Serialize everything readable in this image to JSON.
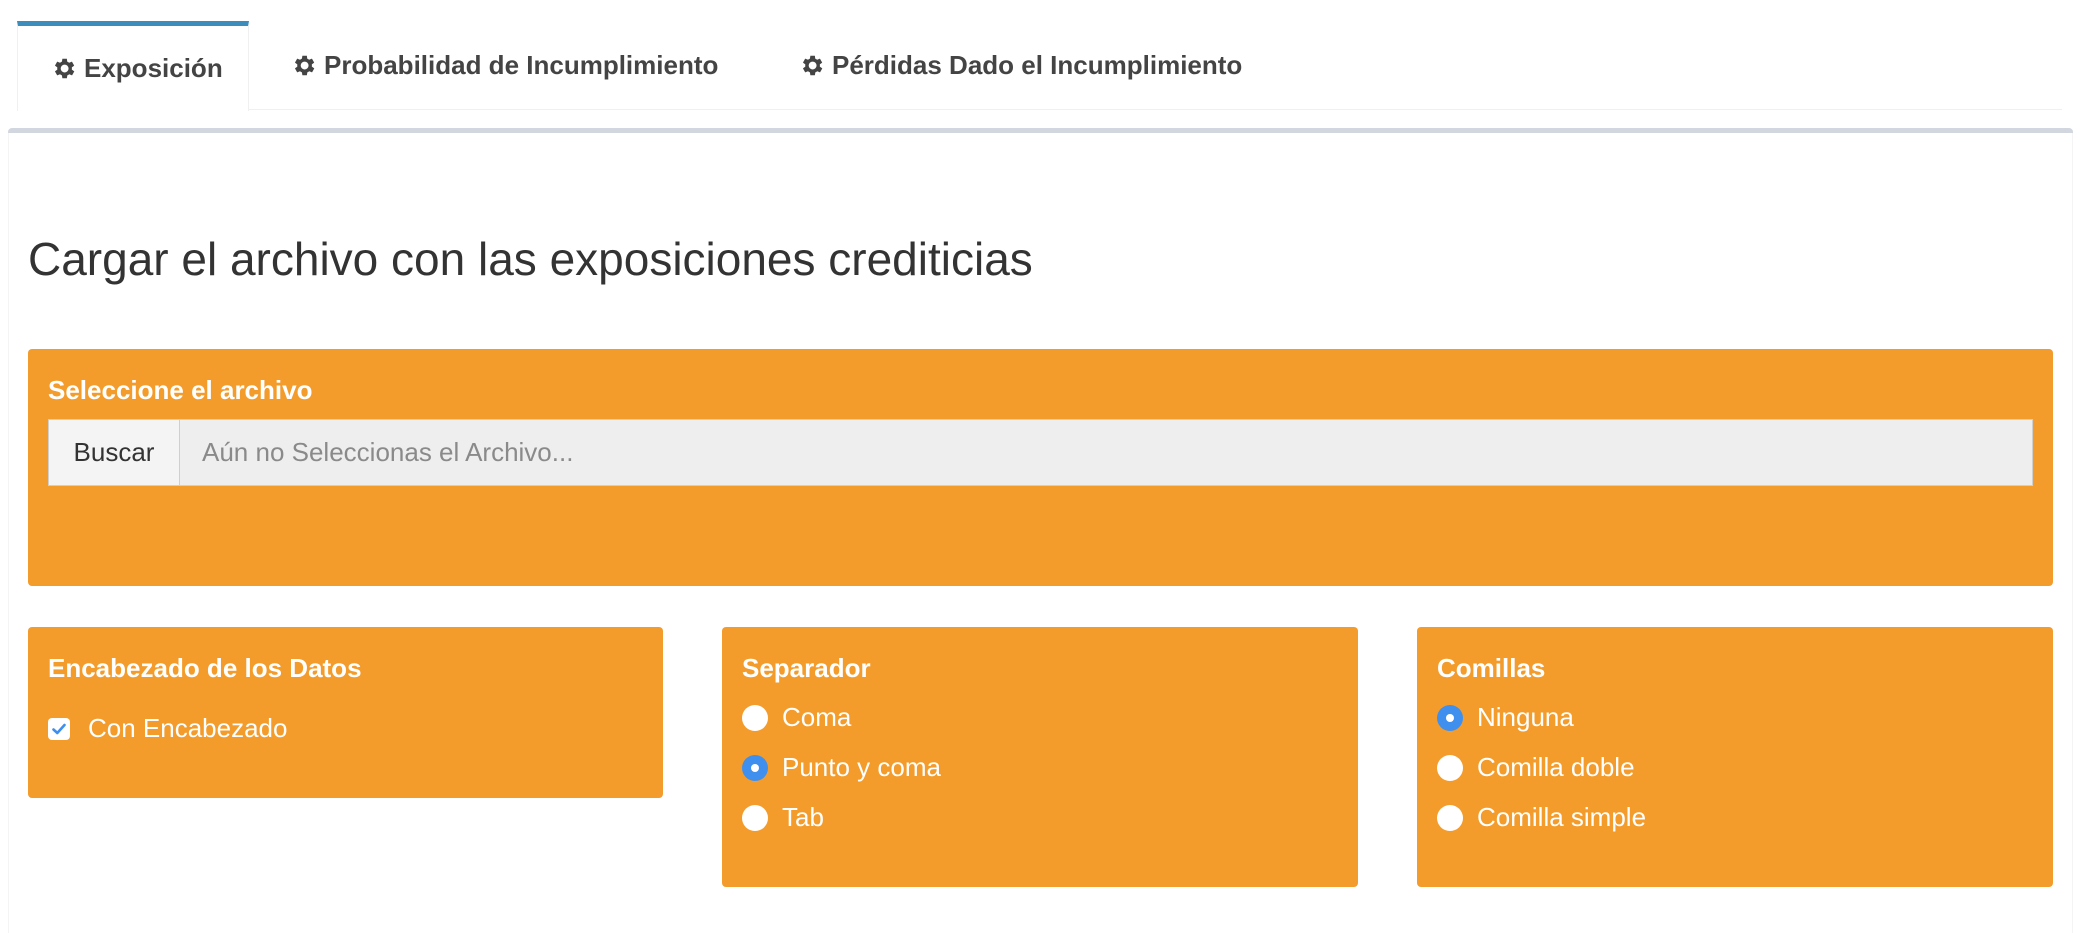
{
  "tabs": [
    {
      "label": "Exposición",
      "icon": "gear-icon",
      "active": true
    },
    {
      "label": "Probabilidad de Incumplimiento",
      "icon": "gear-icon",
      "active": false
    },
    {
      "label": "Pérdidas Dado el Incumplimiento",
      "icon": "gear-icon",
      "active": false
    }
  ],
  "page_title": "Cargar el archivo con las exposiciones crediticias",
  "file_box": {
    "title": "Seleccione el archivo",
    "browse_label": "Buscar",
    "placeholder": "Aún no Seleccionas el Archivo..."
  },
  "header_box": {
    "title": "Encabezado de los Datos",
    "checkbox_label": "Con Encabezado",
    "checked": true
  },
  "separator_box": {
    "title": "Separador",
    "options": [
      {
        "label": "Coma",
        "checked": false
      },
      {
        "label": "Punto y coma",
        "checked": true
      },
      {
        "label": "Tab",
        "checked": false
      }
    ]
  },
  "quote_box": {
    "title": "Comillas",
    "options": [
      {
        "label": "Ninguna",
        "checked": true
      },
      {
        "label": "Comilla doble",
        "checked": false
      },
      {
        "label": "Comilla simple",
        "checked": false
      }
    ]
  },
  "colors": {
    "accent_orange": "#f39c2b",
    "tab_active_border": "#3c8dbc",
    "radio_checked": "#3f8fef"
  }
}
